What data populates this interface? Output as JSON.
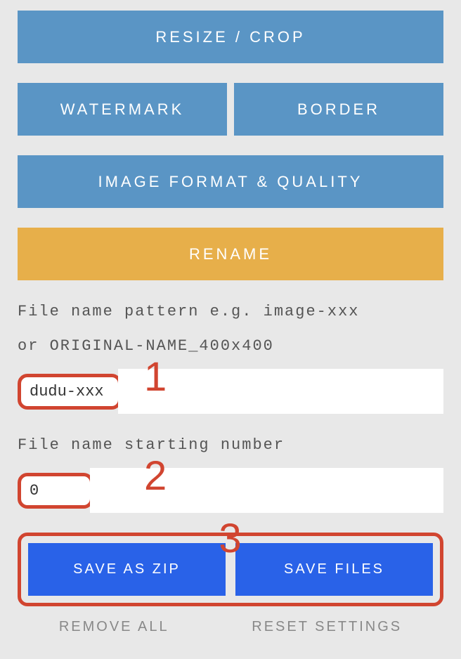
{
  "accordion": {
    "resize_crop": "RESIZE / CROP",
    "watermark": "WATERMARK",
    "border": "BORDER",
    "image_format": "IMAGE FORMAT & QUALITY",
    "rename": "RENAME"
  },
  "rename_section": {
    "pattern_label_line1": "File name pattern e.g. image-xxx",
    "pattern_label_line2": "or ORIGINAL-NAME_400x400",
    "pattern_value": "dudu-xxx",
    "starting_number_label": "File name starting number",
    "starting_number_value": "0"
  },
  "annotations": {
    "one": "1",
    "two": "2",
    "three": "3"
  },
  "actions": {
    "save_zip": "SAVE AS ZIP",
    "save_files": "SAVE FILES",
    "remove_all": "REMOVE ALL",
    "reset_settings": "RESET SETTINGS"
  }
}
